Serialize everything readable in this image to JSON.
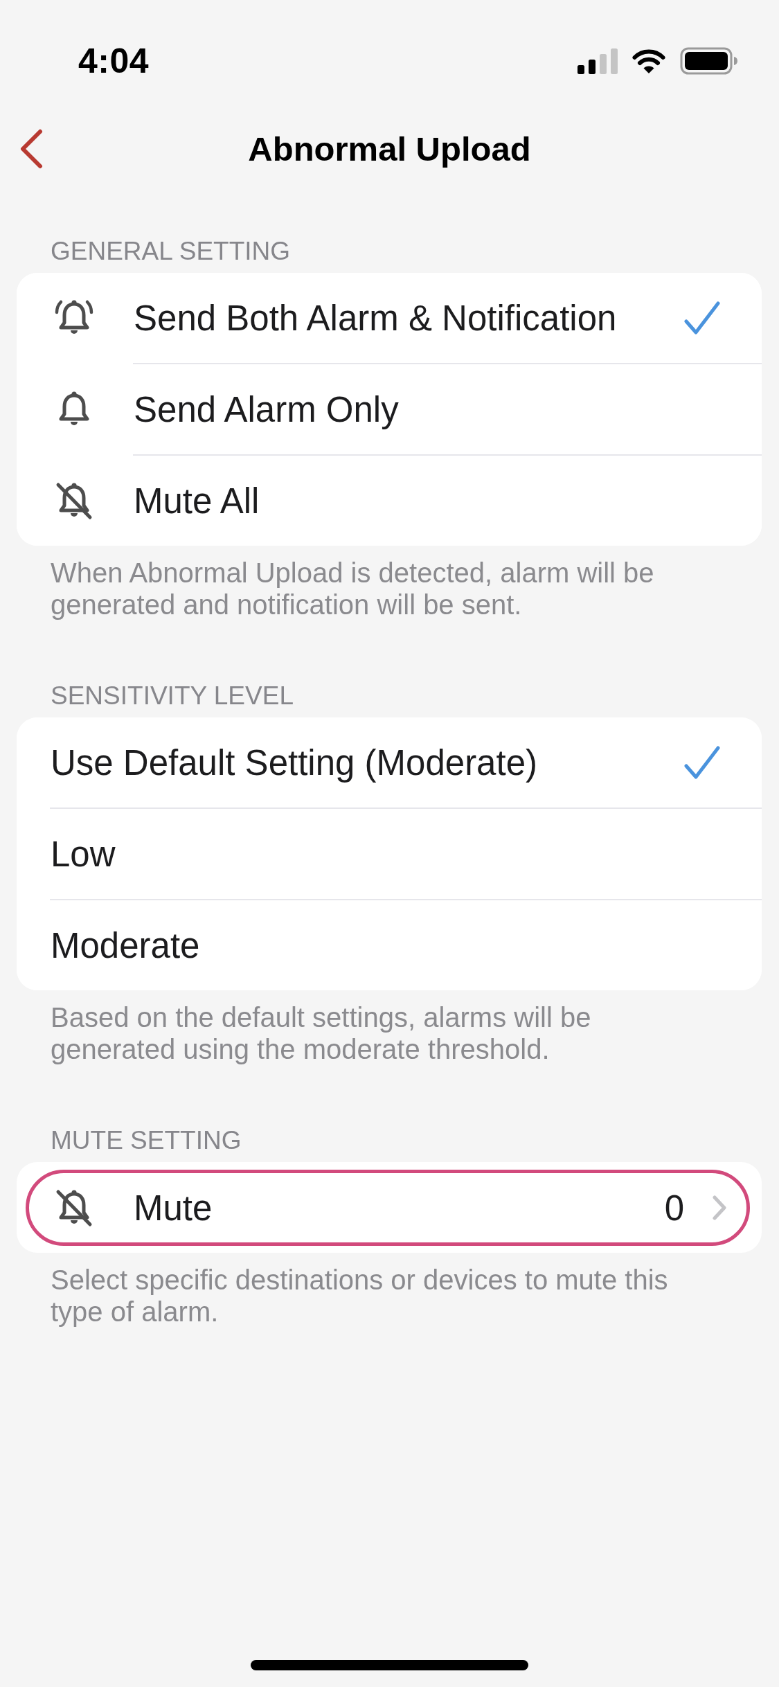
{
  "status_bar": {
    "time": "4:04"
  },
  "nav_bar": {
    "title": "Abnormal Upload"
  },
  "sections": [
    {
      "kind": "icon-options",
      "header": "GENERAL SETTING",
      "rows": [
        {
          "label": "Send Both Alarm & Notification",
          "selected": true
        },
        {
          "label": "Send Alarm Only",
          "selected": false
        },
        {
          "label": "Mute All",
          "selected": false
        }
      ],
      "footer": "When Abnormal Upload is detected, alarm will be generated and notification will be sent."
    },
    {
      "kind": "options",
      "header": "SENSITIVITY LEVEL",
      "rows": [
        {
          "label": "Use Default Setting (Moderate)",
          "selected": true
        },
        {
          "label": "Low",
          "selected": false
        },
        {
          "label": "Moderate",
          "selected": false
        }
      ],
      "footer": "Based on the default settings, alarms will be generated using the moderate threshold."
    },
    {
      "kind": "link",
      "header": "MUTE SETTING",
      "rows": [
        {
          "label": "Mute",
          "value": "0",
          "highlighted": true
        }
      ],
      "footer": "Select specific destinations or devices to mute this type of alarm."
    }
  ]
}
